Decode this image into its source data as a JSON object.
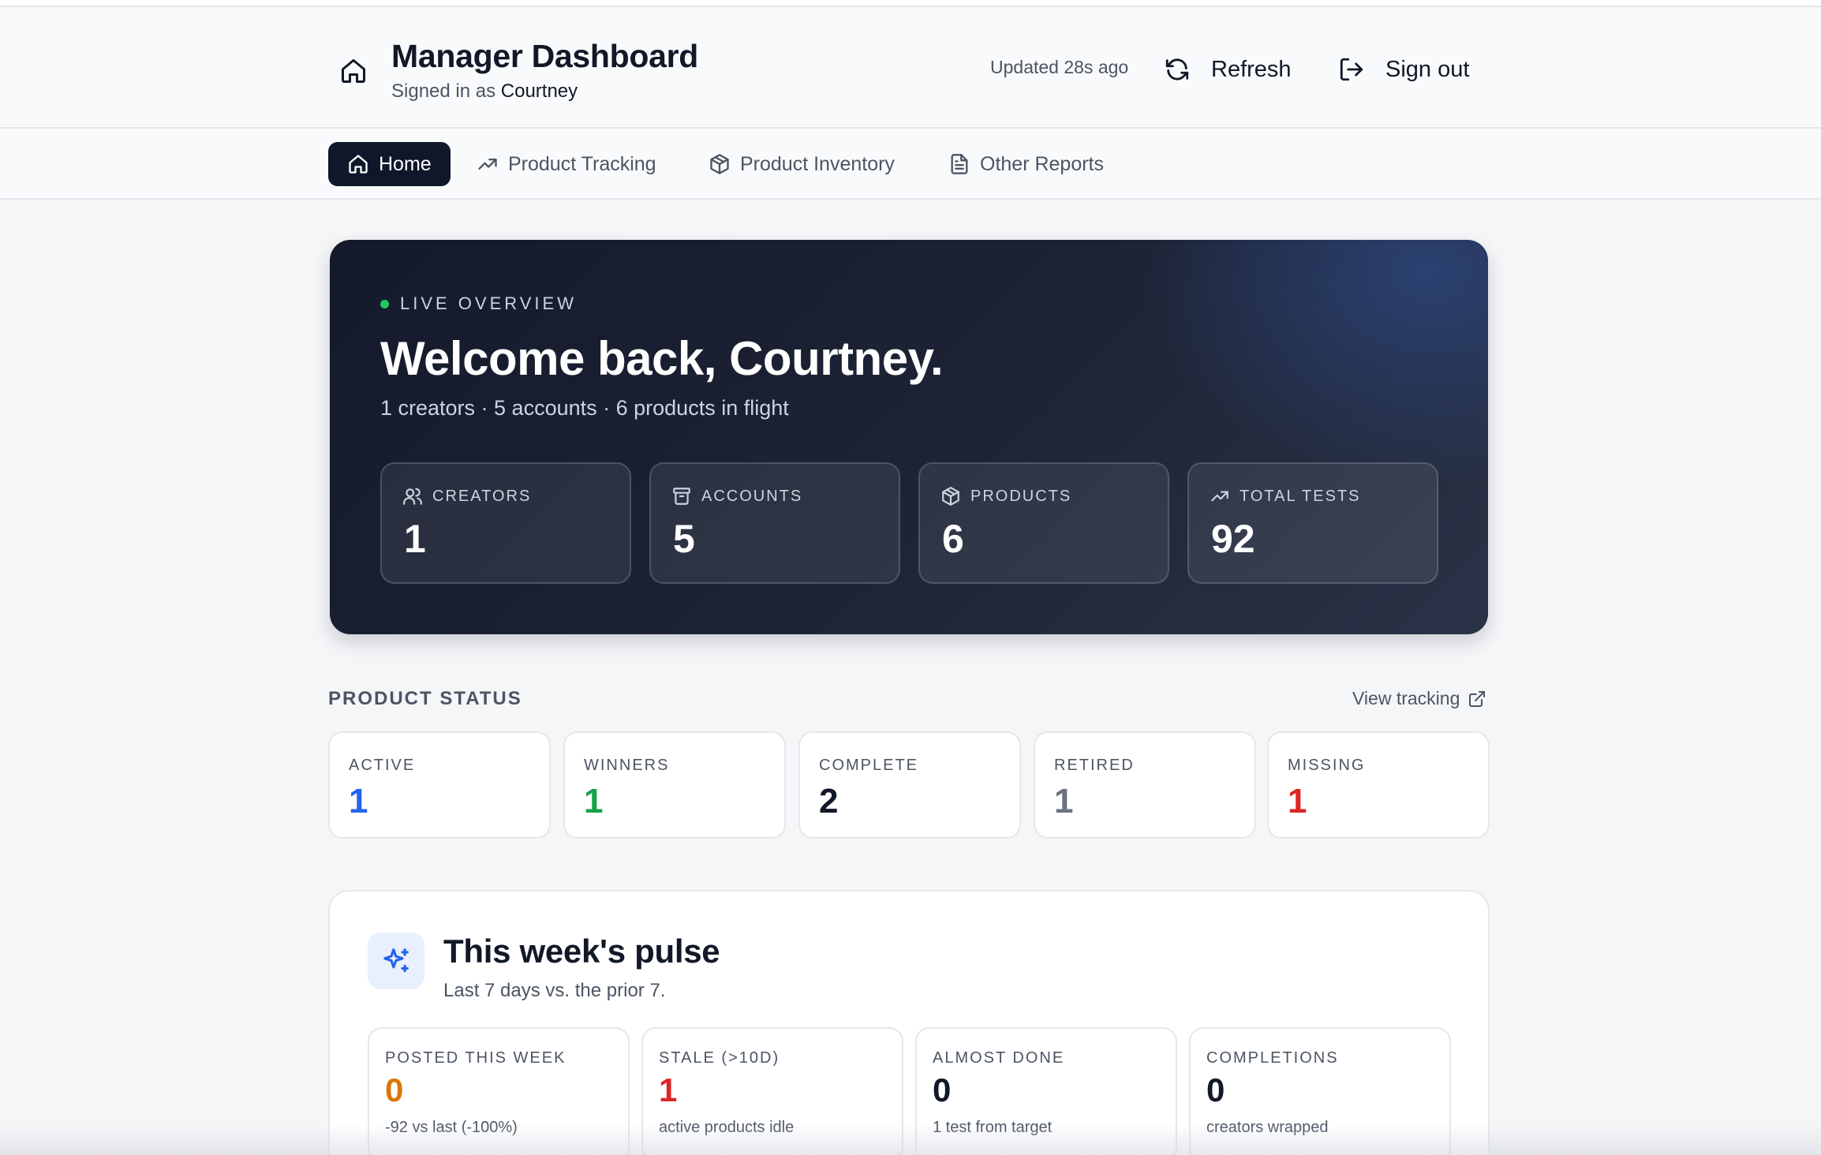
{
  "header": {
    "title": "Manager Dashboard",
    "signed_in_prefix": "Signed in as",
    "user": "Courtney",
    "updated": "Updated 28s ago",
    "refresh_label": "Refresh",
    "signout_label": "Sign out"
  },
  "nav": {
    "tabs": [
      {
        "label": "Home",
        "icon": "home-icon",
        "active": true
      },
      {
        "label": "Product Tracking",
        "icon": "trending-up-icon",
        "active": false
      },
      {
        "label": "Product Inventory",
        "icon": "package-icon",
        "active": false
      },
      {
        "label": "Other Reports",
        "icon": "file-text-icon",
        "active": false
      }
    ]
  },
  "hero": {
    "eyebrow": "LIVE OVERVIEW",
    "welcome": "Welcome back, Courtney.",
    "summary": "1 creators · 5 accounts · 6 products in flight",
    "kpis": [
      {
        "label": "CREATORS",
        "value": "1",
        "icon": "users-icon"
      },
      {
        "label": "ACCOUNTS",
        "value": "5",
        "icon": "archive-icon"
      },
      {
        "label": "PRODUCTS",
        "value": "6",
        "icon": "package-icon"
      },
      {
        "label": "TOTAL TESTS",
        "value": "92",
        "icon": "trending-up-icon"
      }
    ]
  },
  "product_status": {
    "title": "PRODUCT STATUS",
    "link_label": "View tracking",
    "cards": [
      {
        "label": "ACTIVE",
        "value": "1",
        "color": "#2563eb"
      },
      {
        "label": "WINNERS",
        "value": "1",
        "color": "#16a34a"
      },
      {
        "label": "COMPLETE",
        "value": "2",
        "color": "#111827"
      },
      {
        "label": "RETIRED",
        "value": "1",
        "color": "#6b7280"
      },
      {
        "label": "MISSING",
        "value": "1",
        "color": "#dc2626"
      }
    ]
  },
  "pulse": {
    "title": "This week's pulse",
    "subtitle": "Last 7 days vs. the prior 7.",
    "cards": [
      {
        "label": "POSTED THIS WEEK",
        "value": "0",
        "note": "-92 vs last (-100%)",
        "color": "#d97706"
      },
      {
        "label": "STALE (>10D)",
        "value": "1",
        "note": "active products idle",
        "color": "#dc2626"
      },
      {
        "label": "ALMOST DONE",
        "value": "0",
        "note": "1 test from target",
        "color": "#111827"
      },
      {
        "label": "COMPLETIONS",
        "value": "0",
        "note": "creators wrapped",
        "color": "#111827"
      }
    ]
  }
}
